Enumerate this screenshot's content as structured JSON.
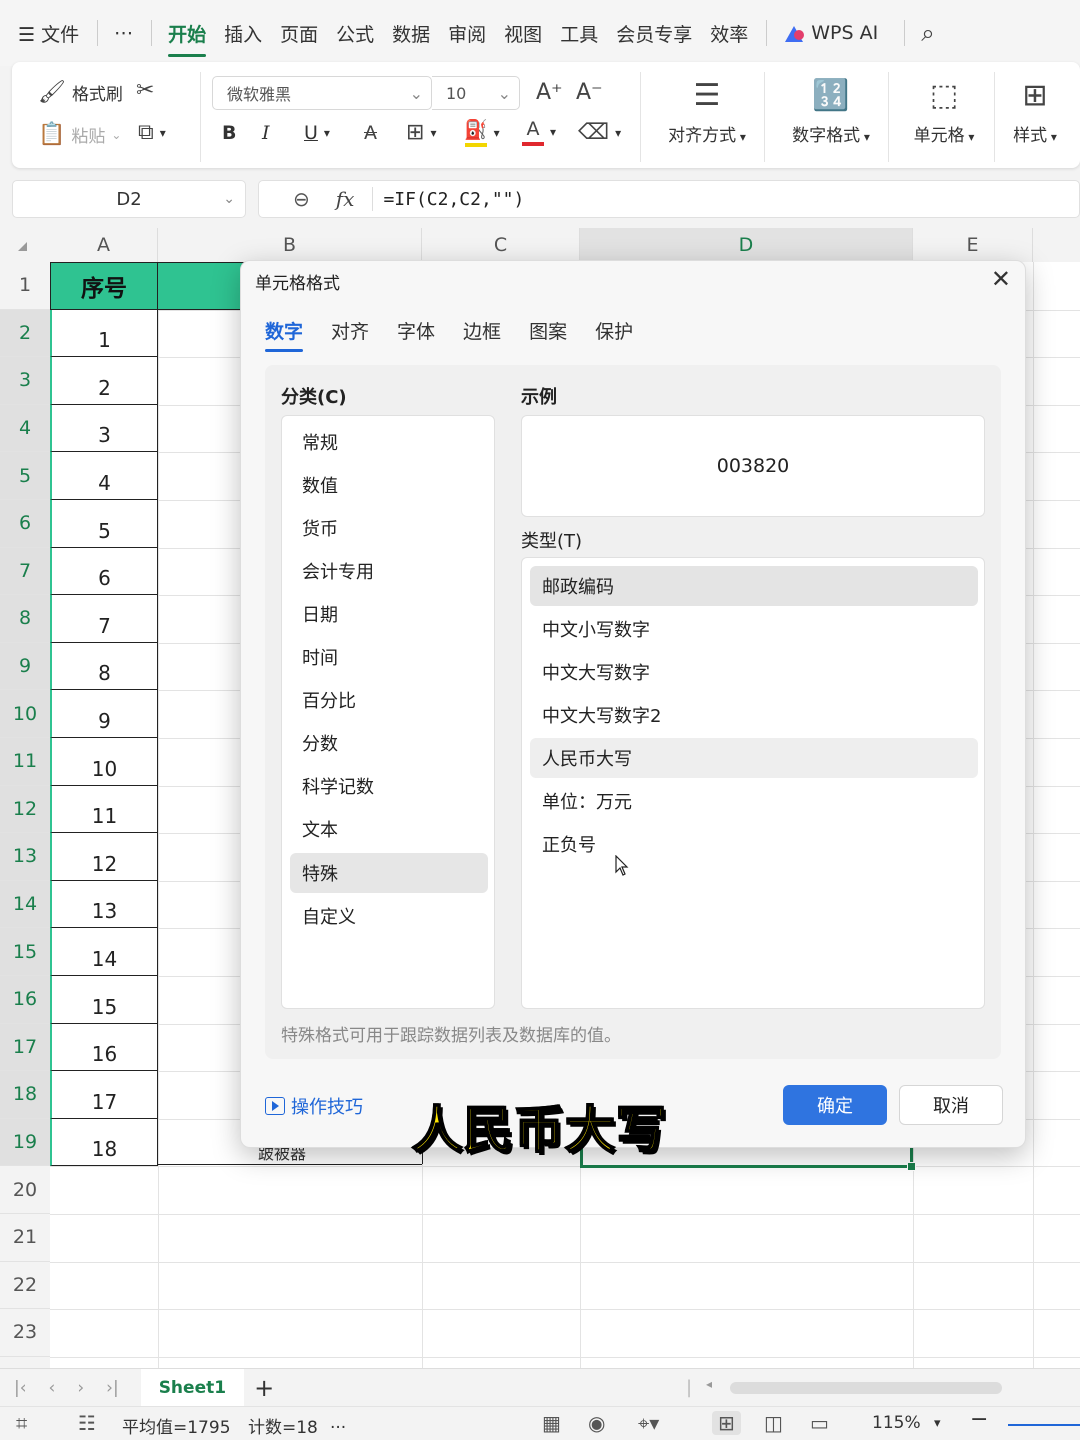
{
  "menubar": {
    "items": [
      "☰ 文件",
      "⋯",
      "开始",
      "插入",
      "页面",
      "公式",
      "数据",
      "审阅",
      "视图",
      "工具",
      "会员专享",
      "效率"
    ],
    "active_index": 2,
    "wps_ai": "WPS AI"
  },
  "ribbon": {
    "format_painter": "格式刷",
    "paste": "粘贴",
    "font_name": "微软雅黑",
    "font_size": "10",
    "bold": "B",
    "italic": "I",
    "underline": "U",
    "align": "对齐方式",
    "number_format": "数字格式",
    "cell": "单元格",
    "style": "样式",
    "highlight_color": "#f2d600",
    "font_color": "#e0282e"
  },
  "formula_bar": {
    "name_box": "D2",
    "fx": "fx",
    "formula": "=IF(C2,C2,\"\")"
  },
  "grid": {
    "columns": [
      "A",
      "B",
      "C",
      "D",
      "E"
    ],
    "selected_column": "D",
    "rows": [
      "1",
      "2",
      "3",
      "4",
      "5",
      "6",
      "7",
      "8",
      "9",
      "10",
      "11",
      "12",
      "13",
      "14",
      "15",
      "16",
      "17",
      "18",
      "19",
      "20",
      "21",
      "22",
      "23"
    ],
    "header_a": "序号",
    "col_a_values": [
      "1",
      "2",
      "3",
      "4",
      "5",
      "6",
      "7",
      "8",
      "9",
      "10",
      "11",
      "12",
      "13",
      "14",
      "15",
      "16",
      "17",
      "18"
    ],
    "partial_b_row19": "跛被器",
    "header_color": "#2fc391"
  },
  "dialog": {
    "title": "单元格格式",
    "tabs": [
      "数字",
      "对齐",
      "字体",
      "边框",
      "图案",
      "保护"
    ],
    "active_tab": "数字",
    "category_label": "分类(C)",
    "categories": [
      "常规",
      "数值",
      "货币",
      "会计专用",
      "日期",
      "时间",
      "百分比",
      "分数",
      "科学记数",
      "文本",
      "特殊",
      "自定义"
    ],
    "selected_category": "特殊",
    "sample_label": "示例",
    "sample_value": "003820",
    "type_label": "类型(T)",
    "types": [
      "邮政编码",
      "中文小写数字",
      "中文大写数字",
      "中文大写数字2",
      "人民币大写",
      "单位：万元",
      "正负号"
    ],
    "selected_type": "邮政编码",
    "hover_type": "人民币大写",
    "hint": "特殊格式可用于跟踪数据列表及数据库的值。",
    "tips": "操作技巧",
    "ok": "确定",
    "cancel": "取消"
  },
  "caption": "人民币大写",
  "sheet_tabs": {
    "active": "Sheet1",
    "add": "+"
  },
  "statusbar": {
    "average": "平均值=1795",
    "count": "计数=18",
    "more": "...",
    "zoom": "115%"
  }
}
